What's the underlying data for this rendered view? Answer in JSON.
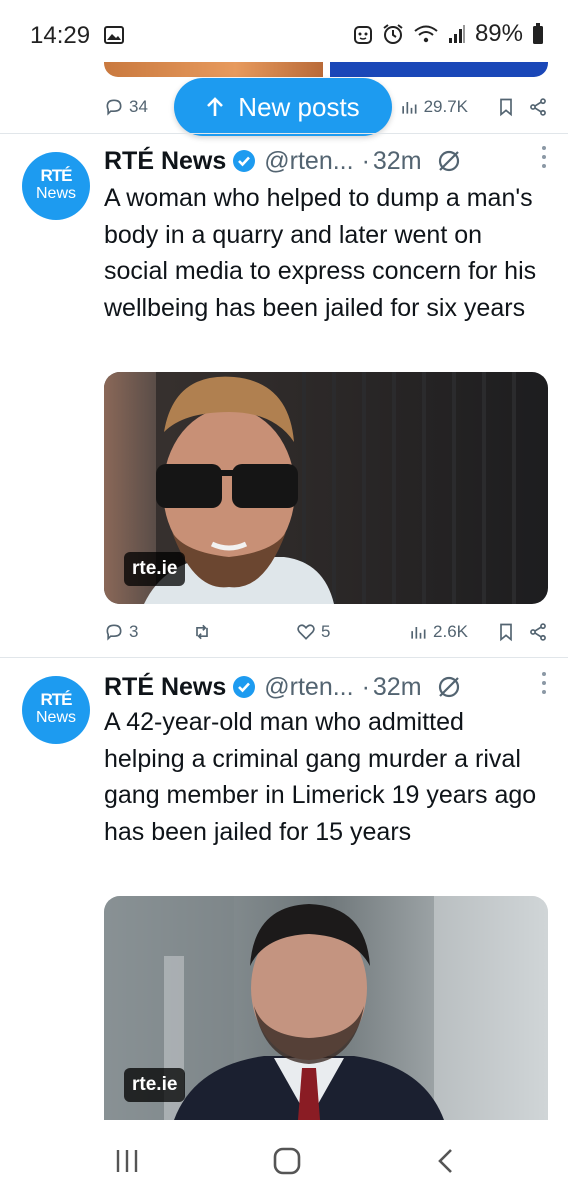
{
  "status_bar": {
    "time": "14:29",
    "battery": "89%"
  },
  "previous_tweet": {
    "replies": "34",
    "views": "29.7K"
  },
  "new_posts_pill": {
    "label": "New posts"
  },
  "tweets": [
    {
      "avatar_line1": "RTÉ",
      "avatar_line2": "News",
      "name": "RTÉ News",
      "handle": "@rten...",
      "dot": "·",
      "time": "32m",
      "text": "A woman who helped to dump a man's body in a quarry and later went on social media to express concern for his wellbeing has been jailed for six years",
      "media_label": "rte.ie",
      "replies": "3",
      "likes": "5",
      "views": "2.6K"
    },
    {
      "avatar_line1": "RTÉ",
      "avatar_line2": "News",
      "name": "RTÉ News",
      "handle": "@rten...",
      "dot": "·",
      "time": "32m",
      "text": "A 42-year-old man who admitted helping a criminal gang murder a rival gang member in Limerick 19 years ago has been jailed for 15 years",
      "media_label": "rte.ie"
    }
  ],
  "nav": {
    "recents": "recents-icon",
    "home": "home-icon",
    "back": "back-icon"
  },
  "colors": {
    "accent": "#1d9bf0",
    "muted": "#536471"
  }
}
